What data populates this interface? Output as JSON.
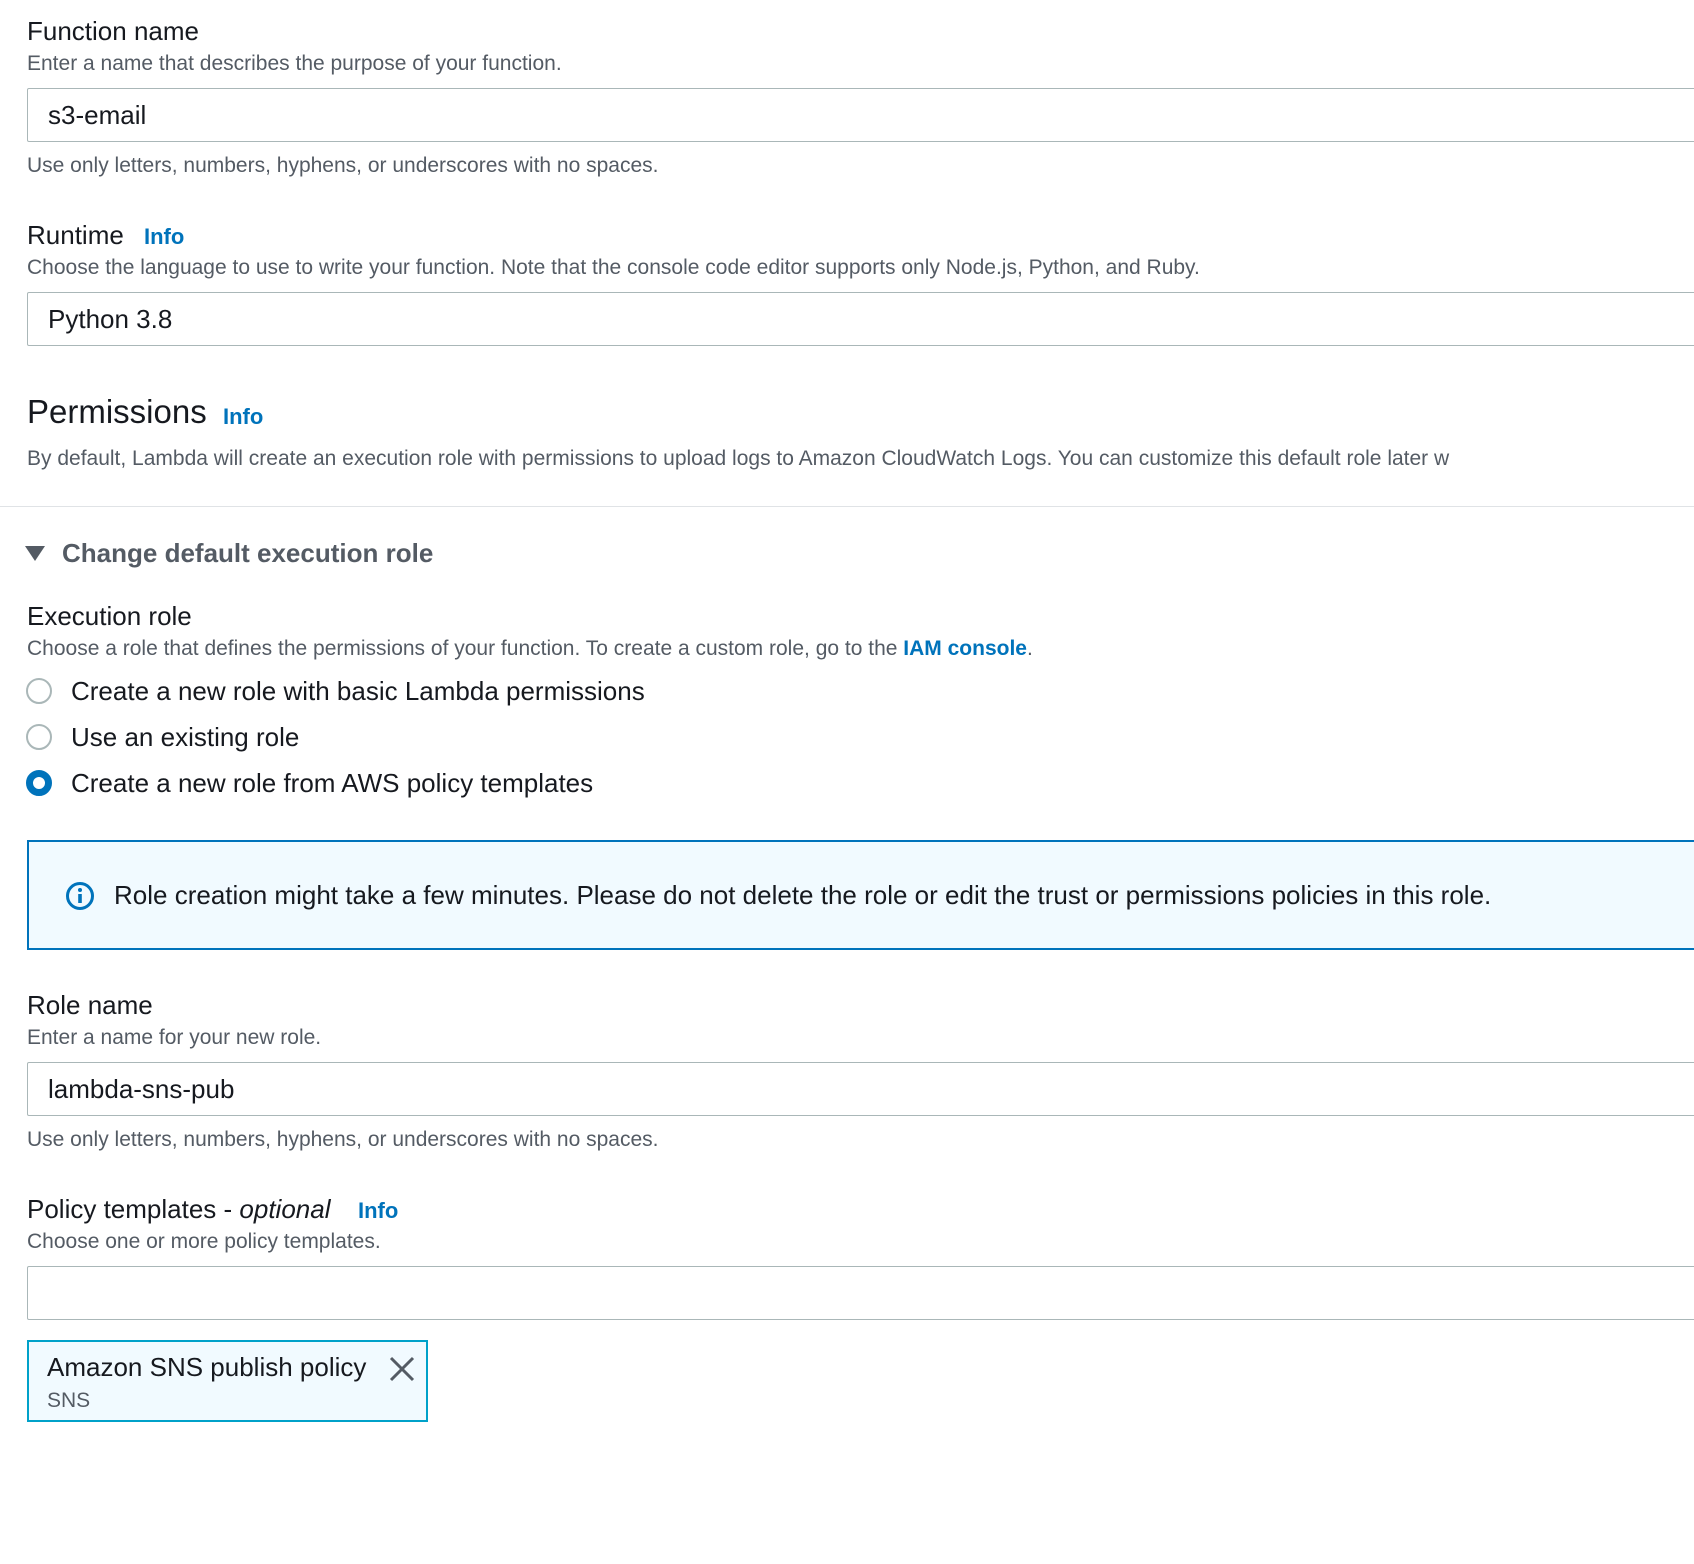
{
  "function_name": {
    "label": "Function name",
    "description": "Enter a name that describes the purpose of your function.",
    "value": "s3-email",
    "constraint": "Use only letters, numbers, hyphens, or underscores with no spaces."
  },
  "runtime": {
    "label": "Runtime",
    "info": "Info",
    "description": "Choose the language to use to write your function. Note that the console code editor supports only Node.js, Python, and Ruby.",
    "value": "Python 3.8"
  },
  "permissions": {
    "title": "Permissions",
    "info": "Info",
    "description": "By default, Lambda will create an execution role with permissions to upload logs to Amazon CloudWatch Logs. You can customize this default role later w"
  },
  "expander": {
    "label": "Change default execution role"
  },
  "execution_role": {
    "label": "Execution role",
    "description_prefix": "Choose a role that defines the permissions of your function. To create a custom role, go to the ",
    "description_link": "IAM console",
    "description_suffix": ".",
    "options": [
      {
        "label": "Create a new role with basic Lambda permissions",
        "selected": false
      },
      {
        "label": "Use an existing role",
        "selected": false
      },
      {
        "label": "Create a new role from AWS policy templates",
        "selected": true
      }
    ]
  },
  "alert": {
    "message": "Role creation might take a few minutes. Please do not delete the role or edit the trust or permissions policies in this role."
  },
  "role_name": {
    "label": "Role name",
    "description": "Enter a name for your new role.",
    "value": "lambda-sns-pub",
    "constraint": "Use only letters, numbers, hyphens, or underscores with no spaces."
  },
  "policy_templates": {
    "label": "Policy templates - ",
    "label_optional": "optional",
    "info": "Info",
    "description": "Choose one or more policy templates.",
    "value": "",
    "selected_tokens": [
      {
        "label": "Amazon SNS publish policy",
        "sublabel": "SNS"
      }
    ]
  },
  "colors": {
    "link": "#0073bb",
    "text": "#16191f",
    "secondary_text": "#545b64",
    "border": "#aab7b8",
    "alert_bg": "#f1faff"
  }
}
